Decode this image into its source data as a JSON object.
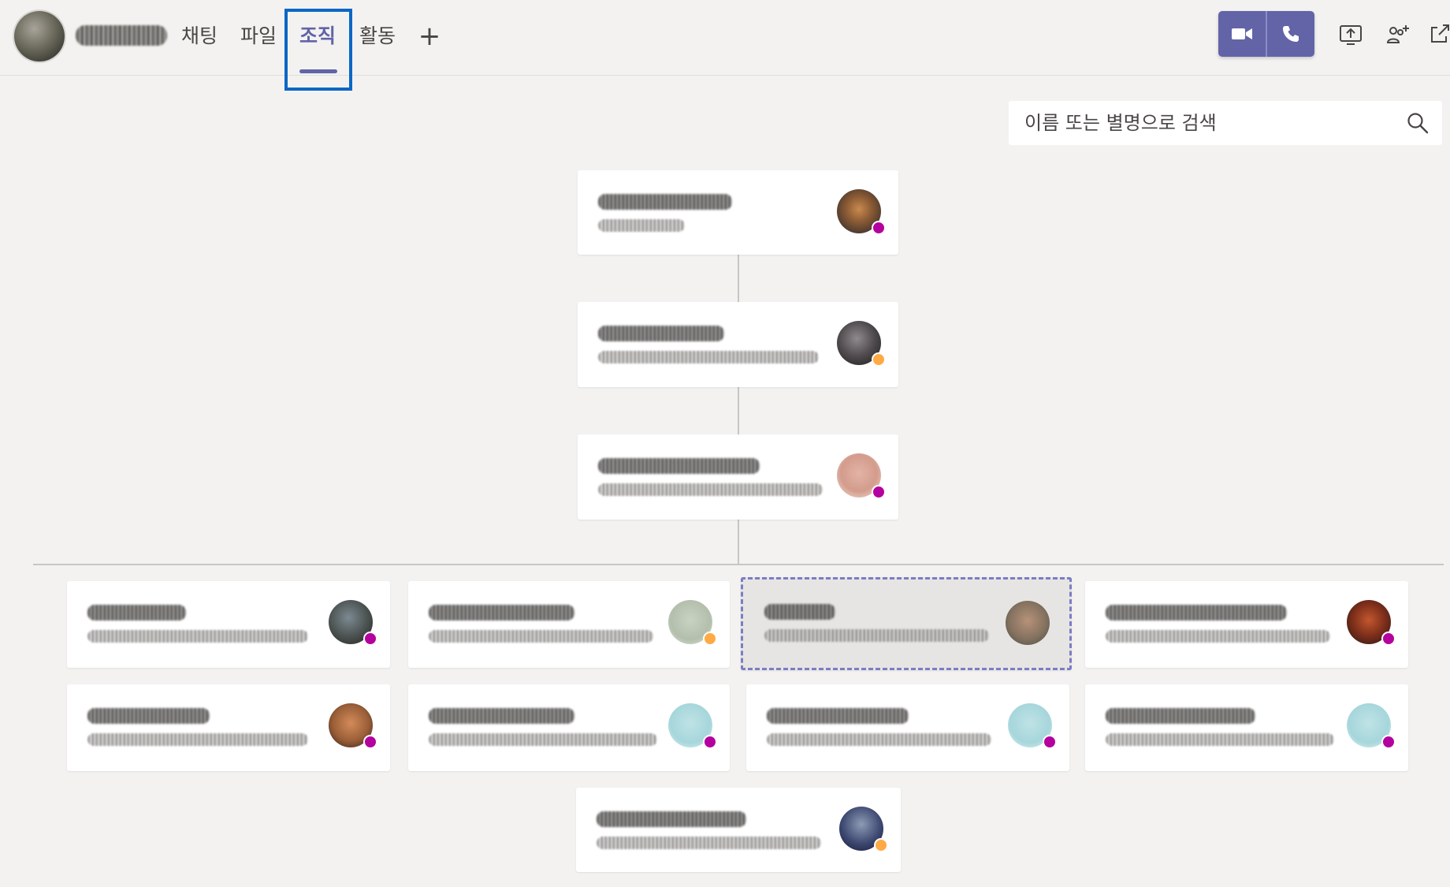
{
  "header": {
    "tabs": [
      {
        "label": "채팅"
      },
      {
        "label": "파일"
      },
      {
        "label": "조직"
      },
      {
        "label": "활동"
      }
    ],
    "add_tab_label": "+"
  },
  "search": {
    "placeholder": "이름 또는 별명으로 검색"
  },
  "colors": {
    "accent": "#6264a7",
    "focus_ring": "#0b67c4",
    "presence_away": "#ffaa44",
    "presence_oof": "#b4009e"
  },
  "org_chart": {
    "cards": [
      {
        "name": "",
        "title": "",
        "presence": "out-of-office",
        "selected": false
      },
      {
        "name": "",
        "title": "",
        "presence": "away",
        "selected": false
      },
      {
        "name": "",
        "title": "",
        "presence": "out-of-office",
        "selected": false
      },
      {
        "name": "",
        "title": "",
        "presence": "out-of-office",
        "selected": false
      },
      {
        "name": "",
        "title": "",
        "presence": "away",
        "selected": false
      },
      {
        "name": "",
        "title": "",
        "presence": "none",
        "selected": true
      },
      {
        "name": "",
        "title": "",
        "presence": "out-of-office",
        "selected": false
      },
      {
        "name": "",
        "title": "",
        "presence": "out-of-office",
        "selected": false
      },
      {
        "name": "",
        "title": "",
        "presence": "out-of-office",
        "selected": false
      },
      {
        "name": "",
        "title": "",
        "presence": "out-of-office",
        "selected": false
      },
      {
        "name": "",
        "title": "",
        "presence": "out-of-office",
        "selected": false
      },
      {
        "name": "",
        "title": "",
        "presence": "away",
        "selected": false
      }
    ]
  }
}
